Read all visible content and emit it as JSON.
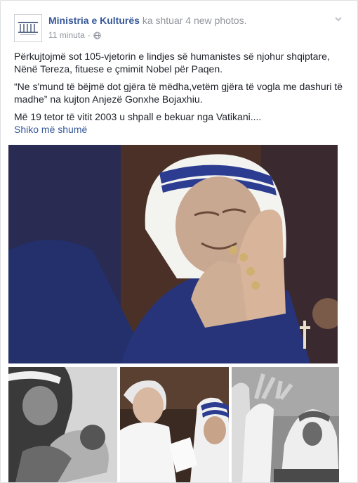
{
  "post": {
    "author": "Ministria e Kulturës",
    "action": "ka shtuar 4 new photos.",
    "timestamp": "11 minuta",
    "separator": "·",
    "audience_icon": "globe-icon",
    "menu_icon": "chevron-down-icon",
    "paragraphs": [
      "Përkujtojmë sot 105-vjetorin e lindjes së humanistes së njohur shqiptare, Nënë Tereza, fituese e çmimit Nobel për Paqen.",
      "“Ne s'mund të bëjmë dot gjëra të mëdha,vetëm gjëra të vogla me dashuri të madhe” na kujton Anjezë Gonxhe Bojaxhiu.",
      "Më 19 tetor të vitit 2003 u shpall e bekuar nga Vatikani...."
    ],
    "see_more": "Shiko më shumë"
  },
  "photos": [
    {
      "name": "photo-main",
      "subject": "Mother Teresa with rosary, praying hands"
    },
    {
      "name": "photo-child",
      "subject": "Mother Teresa holding a child"
    },
    {
      "name": "photo-pope",
      "subject": "Pope John Paul II with Mother Teresa"
    },
    {
      "name": "photo-waving",
      "subject": "Pope waving with Mother Teresa"
    }
  ],
  "colors": {
    "link": "#365899",
    "meta": "#90949c",
    "text": "#1d2129",
    "border": "#dddfe2",
    "habit_blue": "#2c3d91",
    "background": "#e9ebee"
  }
}
